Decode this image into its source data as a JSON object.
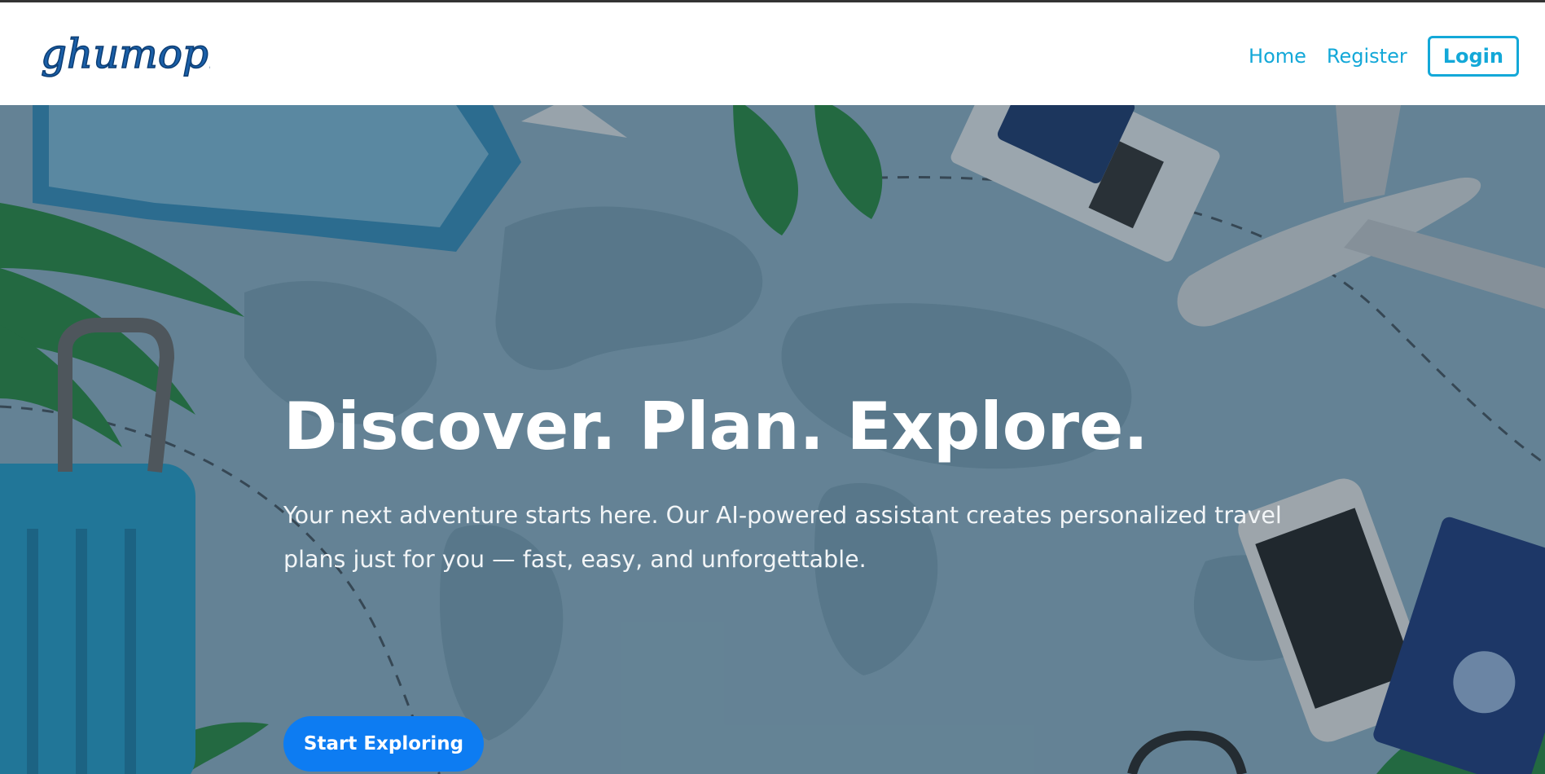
{
  "brand": {
    "logo_text": "ghumophiro"
  },
  "nav": {
    "home": "Home",
    "register": "Register",
    "login": "Login"
  },
  "hero": {
    "title": "Discover. Plan. Explore.",
    "subtitle": "Your next adventure starts here. Our AI-powered assistant creates personalized travel plans just for you — fast, easy, and unforgettable.",
    "cta": "Start Exploring"
  },
  "colors": {
    "accent": "#13a8d8",
    "cta": "#0d7cf2",
    "hero_overlay": "#283c4b"
  },
  "background_image": {
    "subjects": [
      "world-map",
      "palm-leaves",
      "suitcase",
      "airplane",
      "passport",
      "smartphone",
      "boarding-pass"
    ]
  }
}
